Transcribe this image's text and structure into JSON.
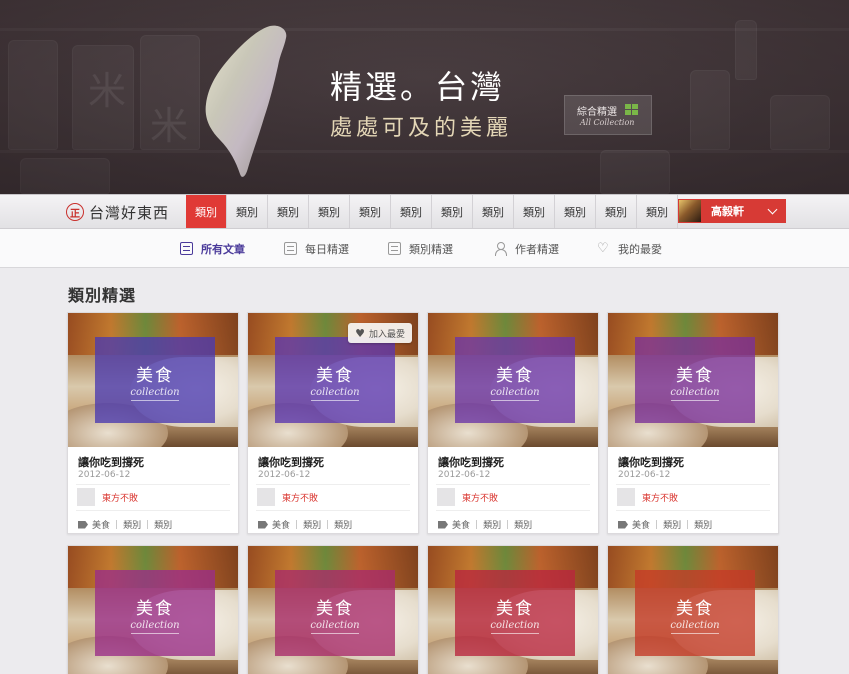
{
  "hero": {
    "title": "精選。台灣",
    "subtitle": "處處可及的美麗",
    "all_collection": {
      "label": "綜合精選",
      "sub": "All Collection"
    }
  },
  "mainnav": {
    "logo_mark": "正",
    "logo_text": "台灣好東西",
    "items": [
      "類別",
      "類別",
      "類別",
      "類別",
      "類別",
      "類別",
      "類別",
      "類別",
      "類別",
      "類別",
      "類別",
      "類別"
    ],
    "active_index": 0,
    "user_name": "高毅軒"
  },
  "subnav": {
    "items": [
      {
        "label": "所有文章",
        "icon": "document-icon",
        "active": true
      },
      {
        "label": "每日精選",
        "icon": "document-icon",
        "active": false
      },
      {
        "label": "類別精選",
        "icon": "document-icon",
        "active": false
      },
      {
        "label": "作者精選",
        "icon": "user-icon",
        "active": false
      },
      {
        "label": "我的最愛",
        "icon": "heart-icon",
        "active": false
      }
    ]
  },
  "section_title": "類別精選",
  "favorite_label": "加入最愛",
  "cards": [
    {
      "category": "美食",
      "category_sub": "collection",
      "overlay_color": "#4a3ab0",
      "title": "讓你吃到撐死",
      "date": "2012-06-12",
      "author": "東方不敗",
      "tags": [
        "美食",
        "類別",
        "類別"
      ]
    },
    {
      "category": "美食",
      "category_sub": "collection",
      "overlay_color": "#5a36b0",
      "title": "讓你吃到撐死",
      "date": "2012-06-12",
      "author": "東方不敗",
      "tags": [
        "美食",
        "類別",
        "類別"
      ],
      "favorite": true
    },
    {
      "category": "美食",
      "category_sub": "collection",
      "overlay_color": "#6a34a8",
      "title": "讓你吃到撐死",
      "date": "2012-06-12",
      "author": "東方不敗",
      "tags": [
        "美食",
        "類別",
        "類別"
      ]
    },
    {
      "category": "美食",
      "category_sub": "collection",
      "overlay_color": "#7a2f98",
      "title": "讓你吃到撐死",
      "date": "2012-06-12",
      "author": "東方不敗",
      "tags": [
        "美食",
        "類別",
        "類別"
      ]
    },
    {
      "category": "美食",
      "category_sub": "collection",
      "overlay_color": "#9a2d88",
      "title": "",
      "date": "",
      "author": "",
      "tags": []
    },
    {
      "category": "美食",
      "category_sub": "collection",
      "overlay_color": "#a82a6a",
      "title": "",
      "date": "",
      "author": "",
      "tags": []
    },
    {
      "category": "美食",
      "category_sub": "collection",
      "overlay_color": "#b8253e",
      "title": "",
      "date": "",
      "author": "",
      "tags": []
    },
    {
      "category": "美食",
      "category_sub": "collection",
      "overlay_color": "#c43a26",
      "title": "",
      "date": "",
      "author": "",
      "tags": []
    }
  ]
}
